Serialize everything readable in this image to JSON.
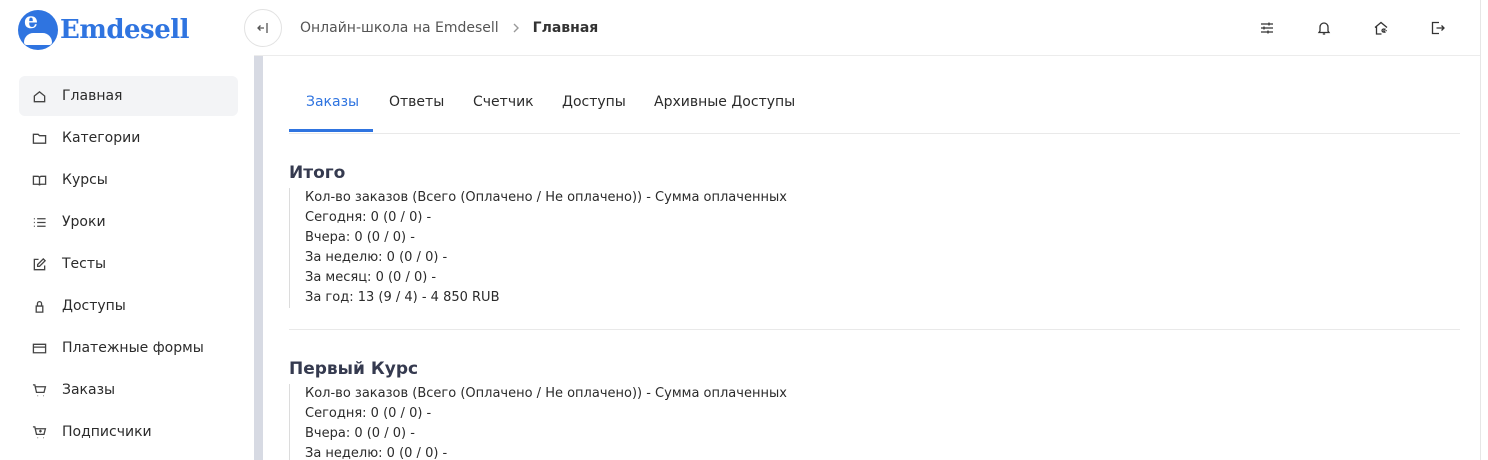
{
  "brand": {
    "name": "Emdesell",
    "badge_letter": "e"
  },
  "sidebar": {
    "items": [
      {
        "label": "Главная",
        "icon": "home-icon",
        "active": true
      },
      {
        "label": "Категории",
        "icon": "folder-icon"
      },
      {
        "label": "Курсы",
        "icon": "book-icon"
      },
      {
        "label": "Уроки",
        "icon": "list-icon"
      },
      {
        "label": "Тесты",
        "icon": "edit-icon"
      },
      {
        "label": "Доступы",
        "icon": "lock-icon"
      },
      {
        "label": "Платежные формы",
        "icon": "credit-card-icon"
      },
      {
        "label": "Заказы",
        "icon": "cart-icon"
      },
      {
        "label": "Подписчики",
        "icon": "cart-plus-icon"
      }
    ]
  },
  "header": {
    "breadcrumb": {
      "link": "Онлайн-школа на Emdesell",
      "current": "Главная"
    },
    "icons": [
      "sliders-icon",
      "bell-icon",
      "home-settings-icon",
      "logout-icon"
    ]
  },
  "tabs": [
    {
      "label": "Заказы",
      "active": true
    },
    {
      "label": "Ответы"
    },
    {
      "label": "Счетчик"
    },
    {
      "label": "Доступы"
    },
    {
      "label": "Архивные Доступы"
    }
  ],
  "sections": [
    {
      "title": "Итого",
      "lines": [
        "Кол-во заказов (Всего (Оплачено / Не оплачено)) - Сумма оплаченных",
        "Сегодня: 0 (0 / 0) -",
        "Вчера: 0 (0 / 0) -",
        "За неделю: 0 (0 / 0) -",
        "За месяц: 0 (0 / 0) -",
        "За год: 13 (9 / 4) - 4 850 RUB"
      ]
    },
    {
      "title": "Первый Курс",
      "lines": [
        "Кол-во заказов (Всего (Оплачено / Не оплачено)) - Сумма оплаченных",
        "Сегодня: 0 (0 / 0) -",
        "Вчера: 0 (0 / 0) -",
        "За неделю: 0 (0 / 0) -"
      ]
    }
  ],
  "colors": {
    "accent": "#2f74e0",
    "active_bg": "#f3f4f6",
    "title": "#353a4f"
  }
}
